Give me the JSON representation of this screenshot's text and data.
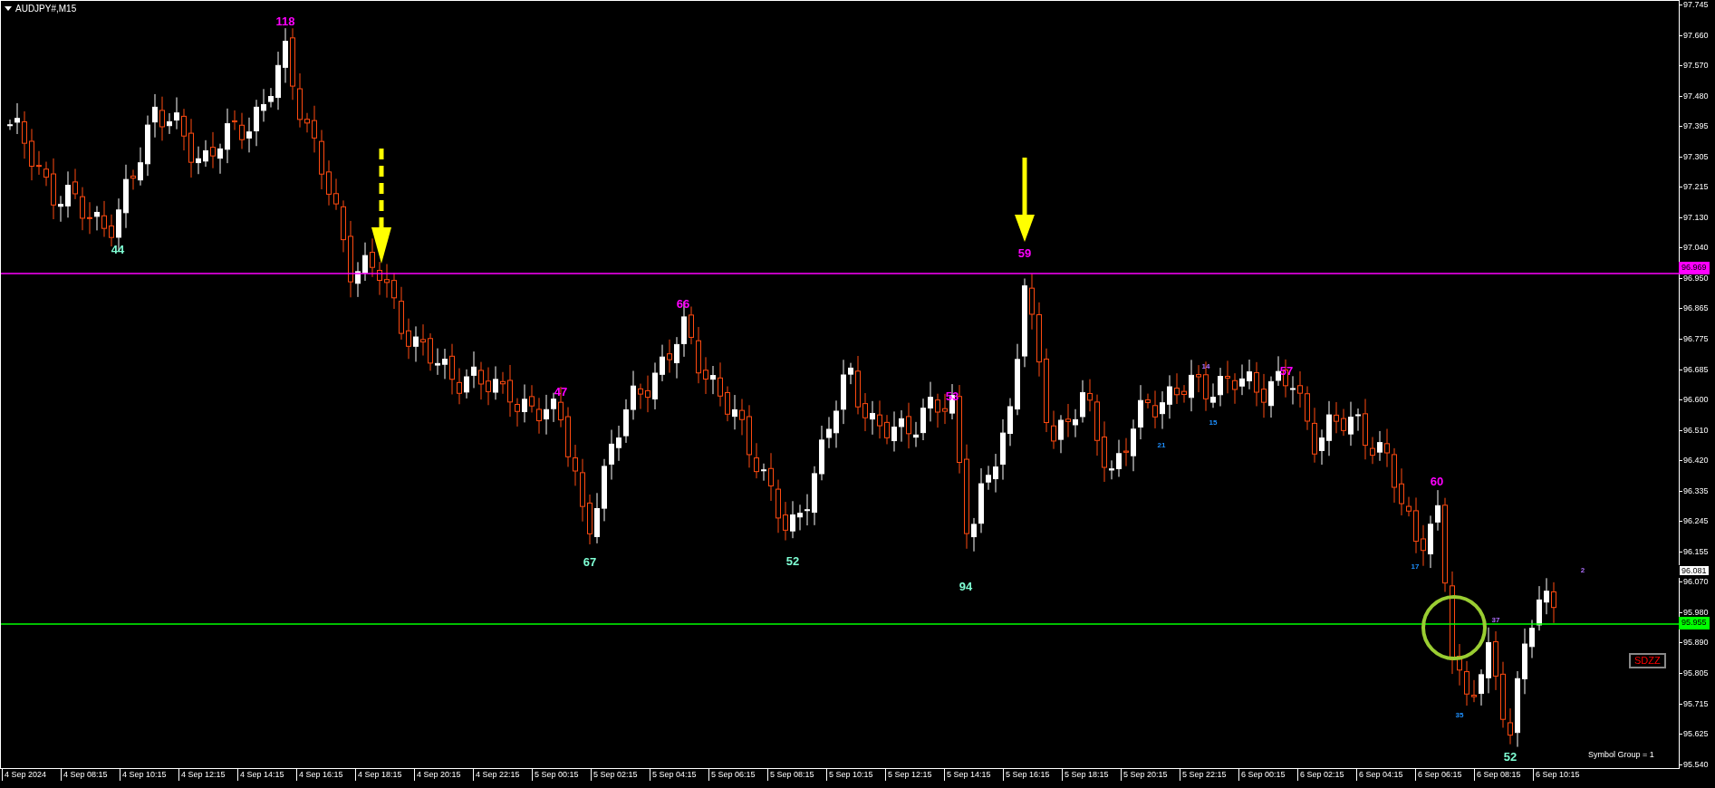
{
  "chart": {
    "title": "AUDJPY#,M15",
    "price_axis": [
      "97.745",
      "97.660",
      "97.570",
      "97.480",
      "97.395",
      "97.305",
      "97.215",
      "97.130",
      "97.040",
      "96.950",
      "96.865",
      "96.775",
      "96.685",
      "96.600",
      "96.510",
      "96.420",
      "96.335",
      "96.245",
      "96.155",
      "96.070",
      "95.980",
      "95.890",
      "95.805",
      "95.715",
      "95.625",
      "95.540"
    ],
    "time_axis": [
      "4 Sep 2024",
      "4 Sep 08:15",
      "4 Sep 10:15",
      "4 Sep 12:15",
      "4 Sep 14:15",
      "4 Sep 16:15",
      "4 Sep 18:15",
      "4 Sep 20:15",
      "4 Sep 22:15",
      "5 Sep 00:15",
      "5 Sep 02:15",
      "5 Sep 04:15",
      "5 Sep 06:15",
      "5 Sep 08:15",
      "5 Sep 10:15",
      "5 Sep 12:15",
      "5 Sep 14:15",
      "5 Sep 16:15",
      "5 Sep 18:15",
      "5 Sep 20:15",
      "5 Sep 22:15",
      "6 Sep 00:15",
      "6 Sep 02:15",
      "6 Sep 04:15",
      "6 Sep 06:15",
      "6 Sep 08:15",
      "6 Sep 10:15"
    ],
    "price_tags": [
      {
        "text": "96.969",
        "color": "#ff00ff",
        "line": true
      },
      {
        "text": "96.081",
        "color": "#ffffff",
        "line": false
      },
      {
        "text": "95.955",
        "color": "#00ff00",
        "line": true
      }
    ],
    "bar_labels": [
      {
        "text": "118",
        "kind": "high"
      },
      {
        "text": "44",
        "kind": "low"
      },
      {
        "text": "47",
        "kind": "high"
      },
      {
        "text": "66",
        "kind": "high"
      },
      {
        "text": "67",
        "kind": "low"
      },
      {
        "text": "52",
        "kind": "low"
      },
      {
        "text": "53",
        "kind": "high"
      },
      {
        "text": "94",
        "kind": "low"
      },
      {
        "text": "59",
        "kind": "high"
      },
      {
        "text": "57",
        "kind": "high"
      },
      {
        "text": "21",
        "kind": "minor_low"
      },
      {
        "text": "15",
        "kind": "minor_low"
      },
      {
        "text": "14",
        "kind": "minor_high"
      },
      {
        "text": "60",
        "kind": "high"
      },
      {
        "text": "17",
        "kind": "minor_low"
      },
      {
        "text": "35",
        "kind": "minor_low"
      },
      {
        "text": "37",
        "kind": "minor_high"
      },
      {
        "text": "52",
        "kind": "low"
      },
      {
        "text": "2",
        "kind": "minor_high"
      }
    ],
    "badge": "SDZZ",
    "footer": "Symbol Group = 1"
  }
}
